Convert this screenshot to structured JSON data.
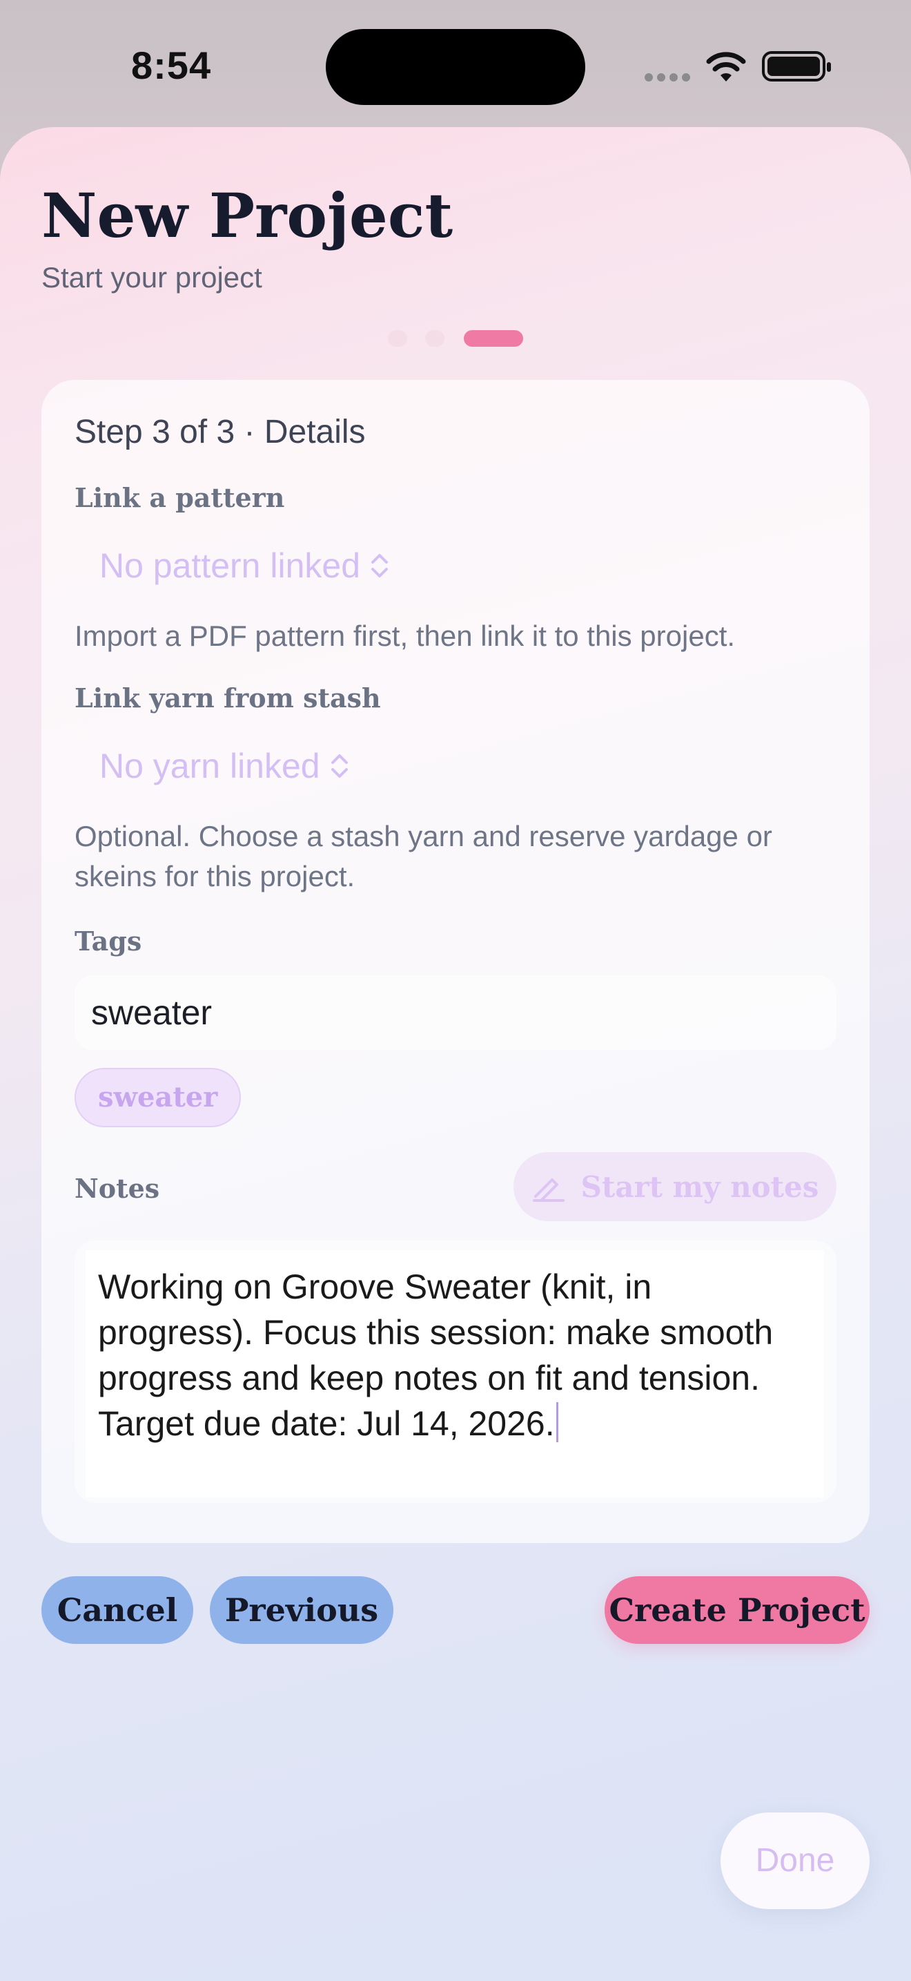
{
  "status_bar": {
    "time": "8:54"
  },
  "header": {
    "title": "New Project",
    "subtitle": "Start your project"
  },
  "stepper": {
    "total_steps": 3,
    "current_step": 3
  },
  "card": {
    "step_label": "Step 3 of 3 · Details",
    "pattern": {
      "label": "Link a pattern",
      "picker_value": "No pattern linked",
      "helper": "Import a PDF pattern first, then link it to this project."
    },
    "yarn": {
      "label": "Link yarn from stash",
      "picker_value": "No yarn linked",
      "helper_line1": "Optional. Choose a stash yarn and reserve yardage or",
      "helper_line2": "skeins for this project."
    },
    "tags": {
      "label": "Tags",
      "input_value": "sweater",
      "chips": [
        "sweater"
      ]
    },
    "notes": {
      "label": "Notes",
      "start_button": "Start my notes",
      "lines": [
        "Working on Groove Sweater (knit, in",
        "progress). Focus this session: make smooth",
        "progress and keep notes on fit and tension.",
        "Target due date: Jul 14, 2026."
      ]
    }
  },
  "actions": {
    "cancel": "Cancel",
    "previous": "Previous",
    "create": "Create Project"
  },
  "keyboard_accessory": {
    "done": "Done"
  },
  "colors": {
    "accent_pink": "#ef7ba5",
    "button_blue": "#8fb2ea",
    "lavender": "#d3bff3"
  }
}
